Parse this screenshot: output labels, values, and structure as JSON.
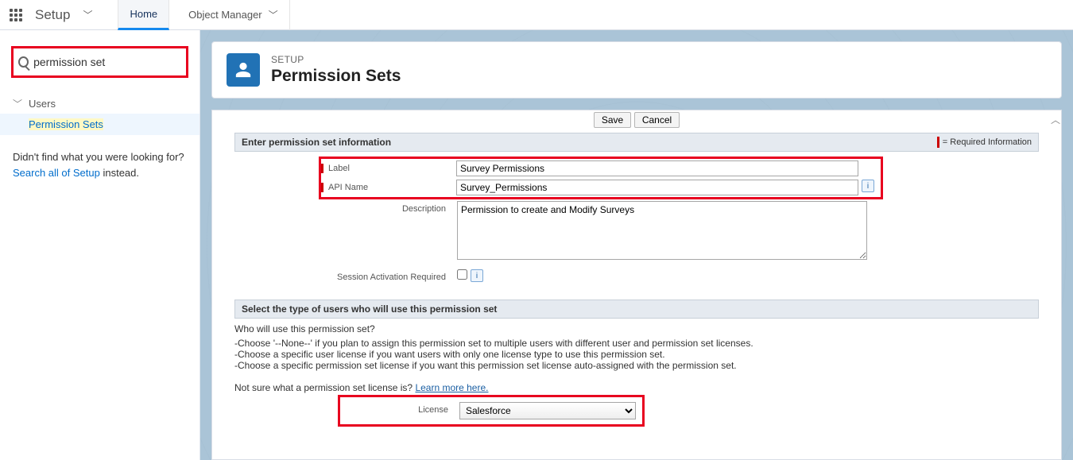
{
  "topnav": {
    "setup_label": "Setup",
    "home_label": "Home",
    "object_manager_label": "Object Manager"
  },
  "sidebar": {
    "search_value": "permission set",
    "section_label": "Users",
    "item_label": "Permission Sets",
    "didnt_find": "Didn't find what you were looking for? ",
    "search_all": "Search all of Setup",
    "instead": " instead."
  },
  "header": {
    "crumb": "SETUP",
    "title": "Permission Sets"
  },
  "buttons": {
    "save": "Save",
    "cancel": "Cancel"
  },
  "section1": {
    "title": "Enter permission set information",
    "required_note": "= Required Information"
  },
  "form": {
    "label_lbl": "Label",
    "label_val": "Survey Permissions",
    "api_lbl": "API Name",
    "api_val": "Survey_Permissions",
    "desc_lbl": "Description",
    "desc_val": "Permission to create and Modify Surveys",
    "sess_lbl": "Session Activation Required"
  },
  "section2": {
    "title": "Select the type of users who will use this permission set"
  },
  "help": {
    "q": "Who will use this permission set?",
    "c1": "-Choose '--None--' if you plan to assign this permission set to multiple users with different user and permission set licenses.",
    "c2": "-Choose a specific user license if you want users with only one license type to use this permission set.",
    "c3": "-Choose a specific permission set license if you want this permission set license auto-assigned with the permission set.",
    "ns": "Not sure what a permission set license is? ",
    "learn": "Learn more here."
  },
  "license": {
    "lbl": "License",
    "val": "Salesforce"
  }
}
